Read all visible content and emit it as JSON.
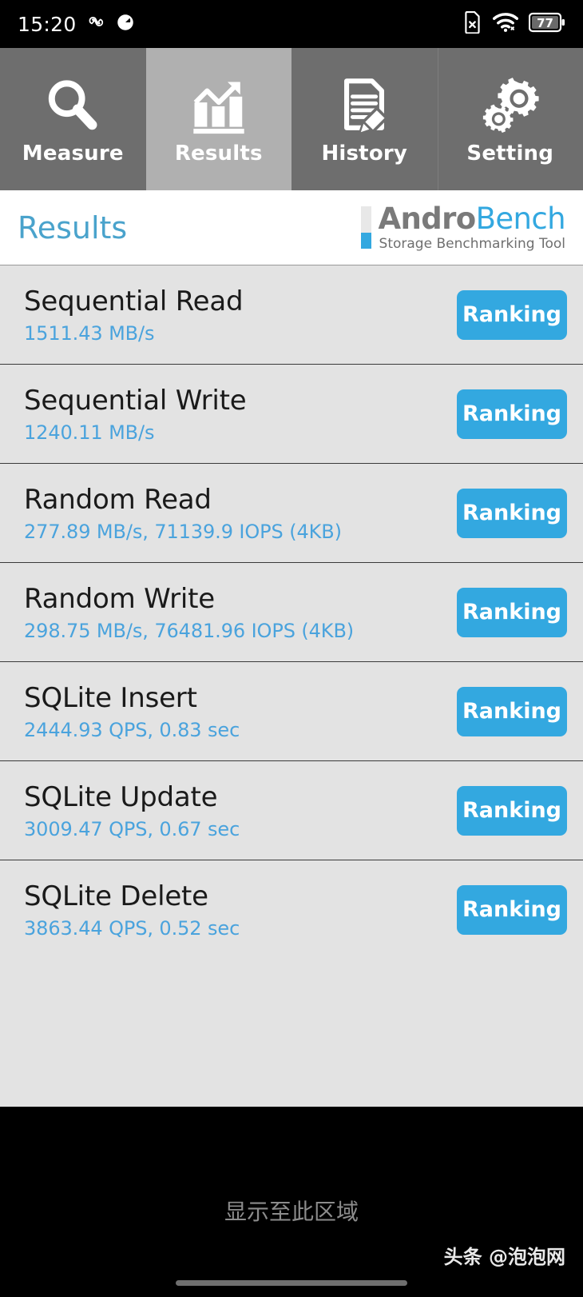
{
  "status_bar": {
    "time": "15:20",
    "left_icons": [
      "sync-icon",
      "speed-dial-icon"
    ],
    "right_icons": [
      "sim-card-off-icon",
      "wifi-icon",
      "battery-icon"
    ],
    "battery_percent": "77"
  },
  "tabs": [
    {
      "label": "Measure",
      "icon": "magnifier-icon",
      "active": false
    },
    {
      "label": "Results",
      "icon": "bar-chart-growth-icon",
      "active": true
    },
    {
      "label": "History",
      "icon": "document-pencil-icon",
      "active": false
    },
    {
      "label": "Setting",
      "icon": "gears-icon",
      "active": false
    }
  ],
  "header": {
    "title": "Results",
    "brand_first": "Andro",
    "brand_second": "Bench",
    "brand_tagline": "Storage Benchmarking Tool"
  },
  "results": [
    {
      "name": "Sequential Read",
      "value": "1511.43 MB/s",
      "button": "Ranking"
    },
    {
      "name": "Sequential Write",
      "value": "1240.11 MB/s",
      "button": "Ranking"
    },
    {
      "name": "Random Read",
      "value": "277.89 MB/s, 71139.9 IOPS (4KB)",
      "button": "Ranking"
    },
    {
      "name": "Random Write",
      "value": "298.75 MB/s, 76481.96 IOPS (4KB)",
      "button": "Ranking"
    },
    {
      "name": "SQLite Insert",
      "value": "2444.93 QPS, 0.83 sec",
      "button": "Ranking"
    },
    {
      "name": "SQLite Update",
      "value": "3009.47 QPS, 0.67 sec",
      "button": "Ranking"
    },
    {
      "name": "SQLite Delete",
      "value": "3863.44 QPS, 0.52 sec",
      "button": "Ranking"
    }
  ],
  "bottom": {
    "hint": "显示至此区域",
    "watermark": "头条 @泡泡网"
  },
  "colors": {
    "accent_blue": "#33a8e0",
    "value_blue": "#4aa3dd",
    "tab_inactive": "#6e6e6e",
    "tab_active": "#b0b0b0",
    "list_bg": "#e3e3e3"
  }
}
